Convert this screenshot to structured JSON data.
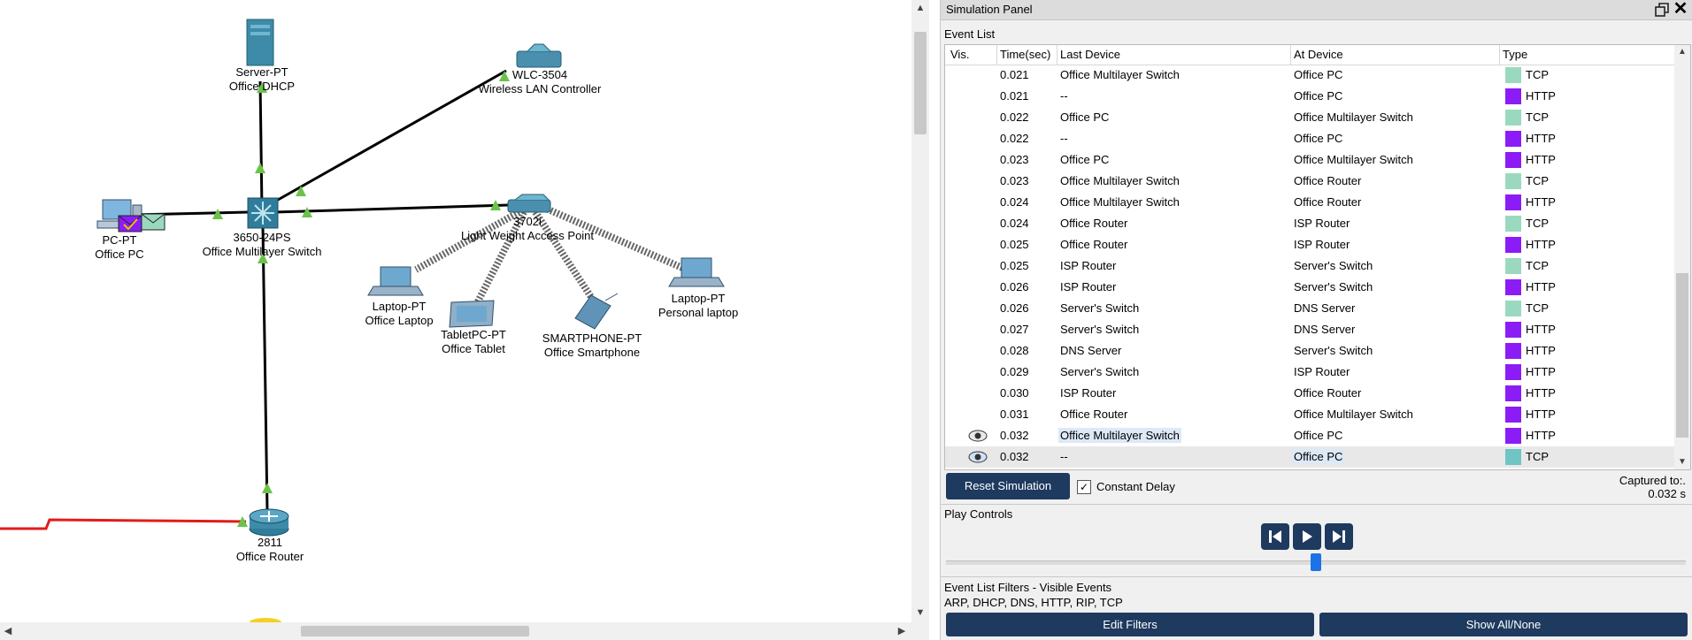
{
  "workspace": {
    "devices": {
      "server": {
        "model": "Server-PT",
        "name": "Office DHCP"
      },
      "wlc": {
        "model": "WLC-3504",
        "name": "Wireless LAN Controller"
      },
      "pc": {
        "model": "PC-PT",
        "name": "Office PC"
      },
      "mls": {
        "model": "3650-24PS",
        "name": "Office Multilayer Switch"
      },
      "ap": {
        "model": "3702i",
        "name": "Light Weight Access Point"
      },
      "laptop": {
        "model": "Laptop-PT",
        "name": "Office Laptop"
      },
      "tablet": {
        "model": "TabletPC-PT",
        "name": "Office Tablet"
      },
      "smartphone": {
        "model": "SMARTPHONE-PT",
        "name": "Office Smartphone"
      },
      "personal_laptop": {
        "model": "Laptop-PT",
        "name": "Personal laptop"
      },
      "router": {
        "model": "2811",
        "name": "Office Router"
      }
    },
    "colors": {
      "link": "#000000",
      "wireless": "#555555",
      "wan": "#e21b1b",
      "port_up": "#6cc24a",
      "device": "#2f7d9a",
      "envelope_tcp": "#9ad9c0",
      "envelope_http": "#8b1cf6"
    }
  },
  "sim_panel": {
    "title": "Simulation Panel",
    "event_list_label": "Event List",
    "columns": {
      "vis": "Vis.",
      "time": "Time(sec)",
      "last": "Last Device",
      "at": "At Device",
      "type": "Type"
    },
    "colors": {
      "TCP": "#9ad9c0",
      "HTTP": "#8b1cf6",
      "TCP_current": "#6fc4c4"
    },
    "events": [
      {
        "time": "0.021",
        "last": "Office Multilayer Switch",
        "at": "Office PC",
        "type": "TCP"
      },
      {
        "time": "0.021",
        "last": "--",
        "at": "Office PC",
        "type": "HTTP"
      },
      {
        "time": "0.022",
        "last": "Office PC",
        "at": "Office Multilayer Switch",
        "type": "TCP"
      },
      {
        "time": "0.022",
        "last": "--",
        "at": "Office PC",
        "type": "HTTP"
      },
      {
        "time": "0.023",
        "last": "Office PC",
        "at": "Office Multilayer Switch",
        "type": "HTTP"
      },
      {
        "time": "0.023",
        "last": "Office Multilayer Switch",
        "at": "Office Router",
        "type": "TCP"
      },
      {
        "time": "0.024",
        "last": "Office Multilayer Switch",
        "at": "Office Router",
        "type": "HTTP"
      },
      {
        "time": "0.024",
        "last": "Office Router",
        "at": "ISP Router",
        "type": "TCP"
      },
      {
        "time": "0.025",
        "last": "Office Router",
        "at": "ISP Router",
        "type": "HTTP"
      },
      {
        "time": "0.025",
        "last": "ISP Router",
        "at": "Server's Switch",
        "type": "TCP"
      },
      {
        "time": "0.026",
        "last": "ISP Router",
        "at": "Server's Switch",
        "type": "HTTP"
      },
      {
        "time": "0.026",
        "last": "Server's Switch",
        "at": "DNS Server",
        "type": "TCP"
      },
      {
        "time": "0.027",
        "last": "Server's Switch",
        "at": "DNS Server",
        "type": "HTTP"
      },
      {
        "time": "0.028",
        "last": "DNS Server",
        "at": "Server's Switch",
        "type": "HTTP"
      },
      {
        "time": "0.029",
        "last": "Server's Switch",
        "at": "ISP Router",
        "type": "HTTP"
      },
      {
        "time": "0.030",
        "last": "ISP Router",
        "at": "Office Router",
        "type": "HTTP"
      },
      {
        "time": "0.031",
        "last": "Office Router",
        "at": "Office Multilayer Switch",
        "type": "HTTP"
      },
      {
        "time": "0.032",
        "last": "Office Multilayer Switch",
        "at": "Office PC",
        "type": "HTTP",
        "visible": true
      },
      {
        "time": "0.032",
        "last": "--",
        "at": "Office PC",
        "type": "TCP",
        "visible": true,
        "current": true
      }
    ],
    "reset_label": "Reset Simulation",
    "constant_delay_label": "Constant Delay",
    "constant_delay_checked": true,
    "captured_label": "Captured to:.",
    "captured_value": "0.032 s",
    "play_controls_label": "Play Controls",
    "play_buttons": [
      "skip-back",
      "play",
      "skip-forward"
    ],
    "filters_label": "Event List Filters - Visible Events",
    "filters_value": "ARP, DHCP, DNS, HTTP, RIP, TCP",
    "edit_filters_label": "Edit Filters",
    "show_all_label": "Show All/None"
  }
}
